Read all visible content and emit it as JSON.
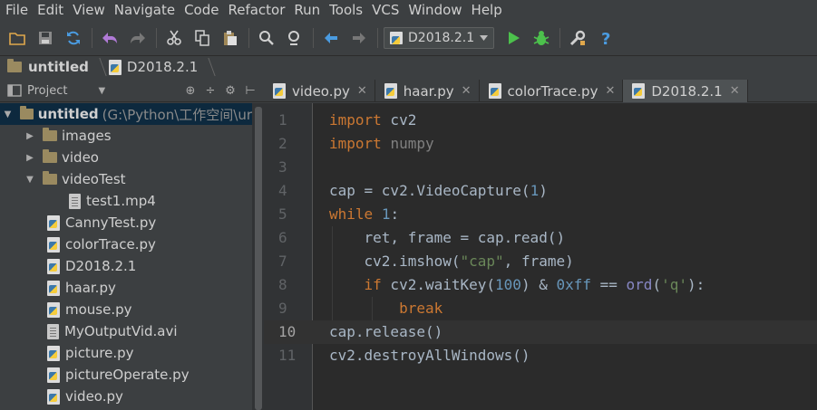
{
  "menu": [
    "File",
    "Edit",
    "View",
    "Navigate",
    "Code",
    "Refactor",
    "Run",
    "Tools",
    "VCS",
    "Window",
    "Help"
  ],
  "toolbar": {
    "run_config": "D2018.2.1",
    "icons": [
      "open-folder-icon",
      "save-icon",
      "sync-icon",
      "undo-icon",
      "redo-icon",
      "cut-icon",
      "copy-icon",
      "paste-icon",
      "find-icon",
      "replace-icon",
      "back-icon",
      "forward-icon",
      "run-icon",
      "debug-icon",
      "settings-icon",
      "help-icon"
    ]
  },
  "breadcrumb": {
    "project": "untitled",
    "file": "D2018.2.1"
  },
  "project_panel": {
    "title": "Project"
  },
  "tree": [
    {
      "label": "untitled",
      "path": "(G:\\Python\\工作空间\\ur",
      "type": "root",
      "expanded": true,
      "depth": 0
    },
    {
      "label": "images",
      "type": "folder",
      "expanded": false,
      "depth": 1
    },
    {
      "label": "video",
      "type": "folder",
      "expanded": false,
      "depth": 1
    },
    {
      "label": "videoTest",
      "type": "folder",
      "expanded": true,
      "depth": 1
    },
    {
      "label": "test1.mp4",
      "type": "file",
      "depth": 2
    },
    {
      "label": "CannyTest.py",
      "type": "py",
      "depth": 1
    },
    {
      "label": "colorTrace.py",
      "type": "py",
      "depth": 1
    },
    {
      "label": "D2018.2.1",
      "type": "py",
      "depth": 1
    },
    {
      "label": "haar.py",
      "type": "py",
      "depth": 1
    },
    {
      "label": "mouse.py",
      "type": "py",
      "depth": 1
    },
    {
      "label": "MyOutputVid.avi",
      "type": "file",
      "depth": 1
    },
    {
      "label": "picture.py",
      "type": "py",
      "depth": 1
    },
    {
      "label": "pictureOperate.py",
      "type": "py",
      "depth": 1
    },
    {
      "label": "video.py",
      "type": "py",
      "depth": 1
    }
  ],
  "tabs": [
    {
      "label": "video.py",
      "active": false
    },
    {
      "label": "haar.py",
      "active": false
    },
    {
      "label": "colorTrace.py",
      "active": false
    },
    {
      "label": "D2018.2.1",
      "active": true
    }
  ],
  "editor": {
    "current_line": 10,
    "lines": [
      "import cv2",
      "import numpy",
      "",
      "cap = cv2.VideoCapture(1)",
      "while 1:",
      "    ret, frame = cap.read()",
      "    cv2.imshow(\"cap\", frame)",
      "    if cv2.waitKey(100) & 0xff == ord('q'):",
      "        break",
      "cap.release()",
      "cv2.destroyAllWindows()"
    ]
  },
  "colors": {
    "keyword": "#cc7832",
    "number": "#6897bb",
    "string": "#6a8759",
    "builtin": "#8888c6",
    "text": "#a9b7c6",
    "background": "#2b2b2b",
    "selection": "#0d293e"
  }
}
